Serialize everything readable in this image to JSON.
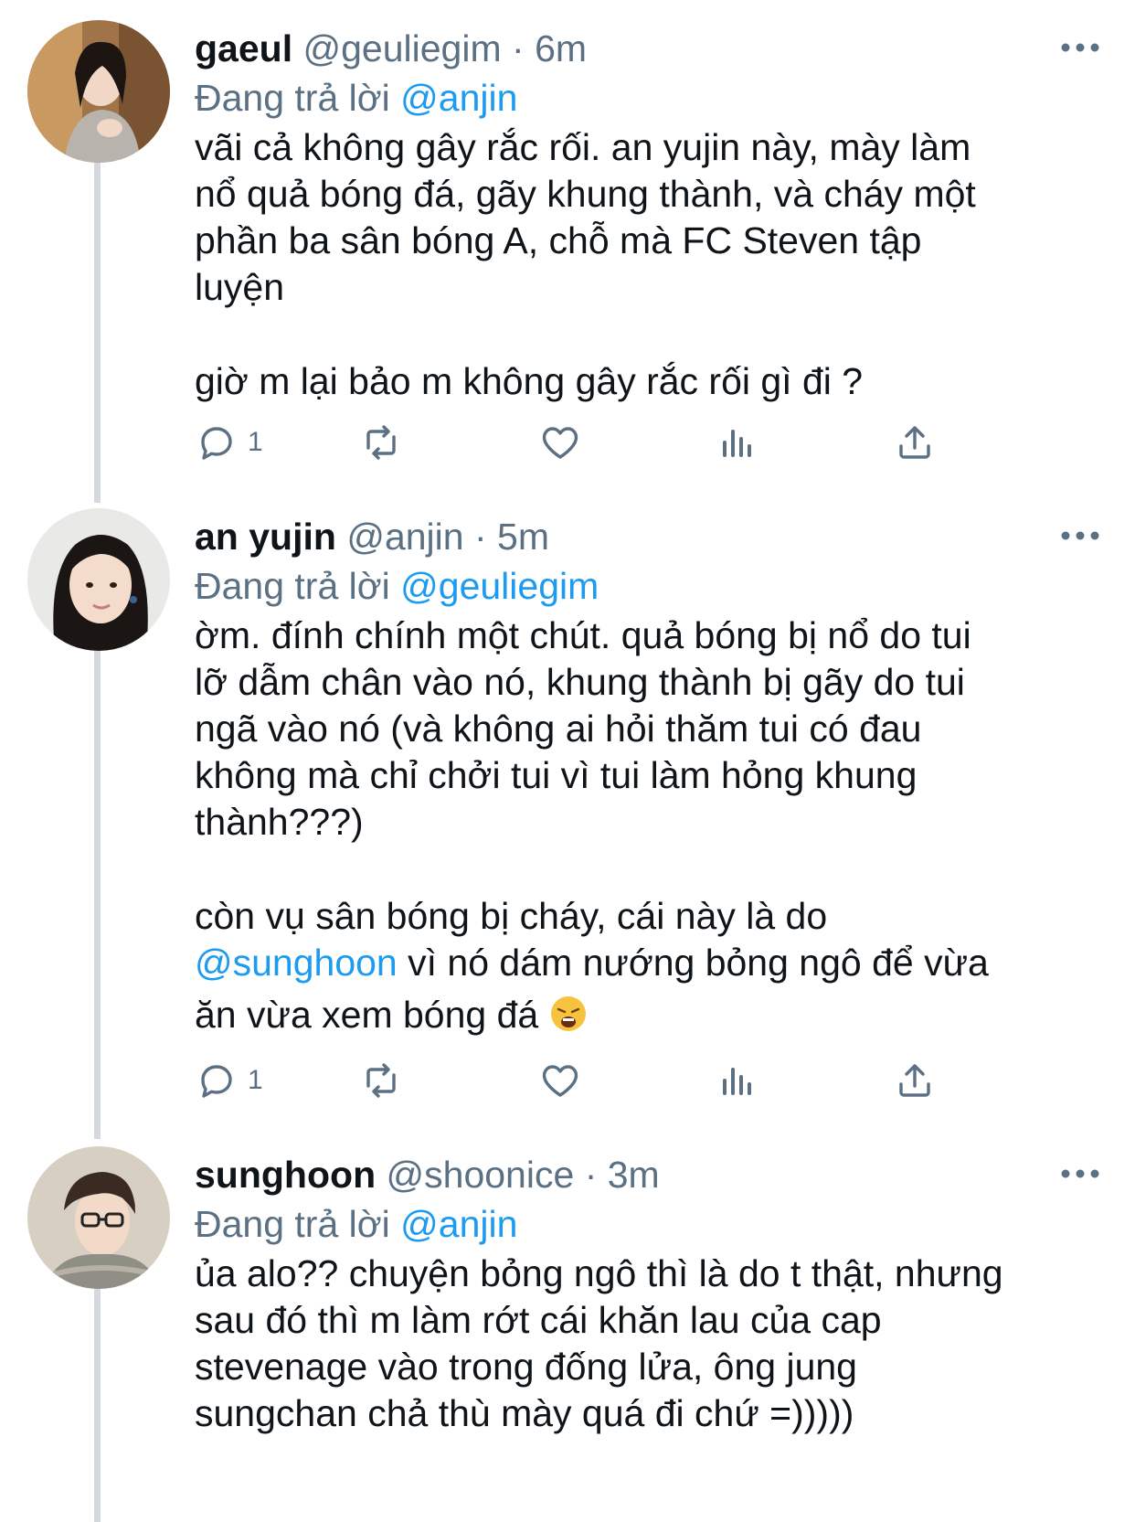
{
  "tweets": [
    {
      "name": "gaeul",
      "handle": "@geuliegim",
      "time": "6m",
      "replying_prefix": "Đang trả lời",
      "replying_to": "@anjin",
      "body_lines": [
        "vãi cả không gây rắc rối. an yujin này, mày làm",
        "nổ quả bóng đá, gãy khung thành, và cháy một",
        "phần ba sân bóng A, chỗ mà FC Steven tập",
        "luyện"
      ],
      "body_lines_2": [
        "giờ m lại bảo m không gây rắc rối gì đi ?"
      ],
      "reply_count": "1"
    },
    {
      "name": "an yujin",
      "handle": "@anjin",
      "time": "5m",
      "replying_prefix": "Đang trả lời",
      "replying_to": "@geuliegim",
      "body_lines": [
        "ờm. đính chính một chút. quả bóng bị nổ do tui",
        "lỡ dẫm chân vào nó, khung thành bị gãy do tui",
        "ngã vào nó (và không ai hỏi thăm tui có đau",
        "không mà chỉ chởi tui vì tui làm hỏng khung",
        "thành???)"
      ],
      "body_line_p2_1": "còn vụ sân bóng bị cháy, cái này là do",
      "body_mention": "@sunghoon",
      "body_line_p2_2": " vì nó dám nướng bỏng ngô để vừa",
      "body_line_p2_3": "ăn vừa xem bóng đá",
      "emoji": "weary-face-icon",
      "reply_count": "1"
    },
    {
      "name": "sunghoon",
      "handle": "@shoonice",
      "time": "3m",
      "replying_prefix": "Đang trả lời",
      "replying_to": "@anjin",
      "body_lines": [
        "ủa alo?? chuyện bỏng ngô thì là do t thật, nhưng",
        "sau đó thì m làm rớt cái khăn lau của cap",
        "stevenage vào trong đống lửa, ông jung",
        "sungchan chả thù mày quá đi chứ =)))))"
      ]
    }
  ],
  "separator": "·",
  "colors": {
    "accent": "#1d9bf0",
    "secondary": "#5b7083",
    "text": "#0f1419",
    "thread_line": "#d3d9de"
  }
}
